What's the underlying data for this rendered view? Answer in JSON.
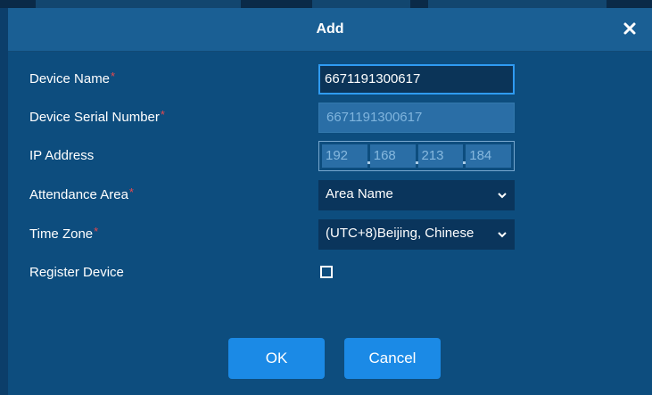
{
  "dialog": {
    "title": "Add",
    "close_icon": "close-icon"
  },
  "form": {
    "device_name": {
      "label": "Device Name",
      "required": "*",
      "value": "6671191300617"
    },
    "serial_number": {
      "label": "Device Serial Number",
      "required": "*",
      "value": "6671191300617"
    },
    "ip_address": {
      "label": "IP Address",
      "segments": [
        "192",
        "168",
        "213",
        "184"
      ]
    },
    "attendance_area": {
      "label": "Attendance Area",
      "required": "*",
      "value": "Area Name",
      "icon": "chevron-down-icon"
    },
    "time_zone": {
      "label": "Time Zone",
      "required": "*",
      "value": "(UTC+8)Beijing, Chinese",
      "icon": "chevron-down-icon"
    },
    "register_device": {
      "label": "Register Device",
      "checked": false
    }
  },
  "buttons": {
    "ok": "OK",
    "cancel": "Cancel"
  },
  "colors": {
    "background": "#0c3e6a",
    "title_bar": "#1a5f94",
    "dialog": "#0d4d7e",
    "button": "#1b8ae6",
    "required_star": "#e5484d",
    "focus_border": "#2f9bf2"
  }
}
